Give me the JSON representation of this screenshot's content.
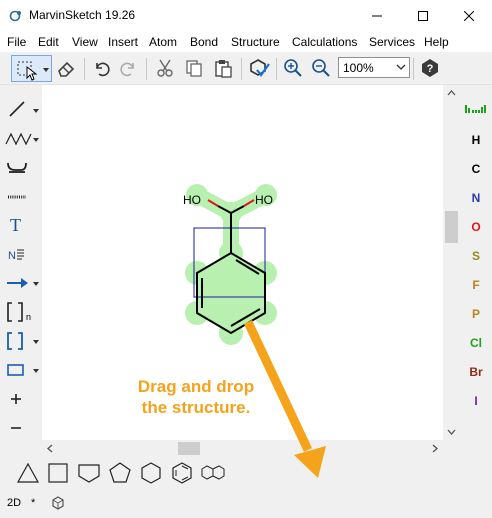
{
  "window": {
    "title": "MarvinSketch 19.26"
  },
  "menu": [
    "File",
    "Edit",
    "View",
    "Insert",
    "Atom",
    "Bond",
    "Structure",
    "Calculations",
    "Services",
    "Help"
  ],
  "toolbar": {
    "zoom_value": "100%",
    "icons": [
      "select-lasso-icon",
      "eraser-icon",
      "undo-icon",
      "redo-icon",
      "cut-icon",
      "copy-icon",
      "paste-icon",
      "clean-structure-icon",
      "zoom-in-icon",
      "zoom-out-icon",
      "help-icon"
    ]
  },
  "left_tools": {
    "text_tool": "T",
    "bracket_label": "n"
  },
  "atoms": [
    {
      "symbol": "H",
      "color": "#000000"
    },
    {
      "symbol": "C",
      "color": "#000000"
    },
    {
      "symbol": "N",
      "color": "#2b3aa8"
    },
    {
      "symbol": "O",
      "color": "#e4141b"
    },
    {
      "symbol": "S",
      "color": "#9b8a1a"
    },
    {
      "symbol": "F",
      "color": "#b8861b"
    },
    {
      "symbol": "P",
      "color": "#b8861b"
    },
    {
      "symbol": "Cl",
      "color": "#1aa31a"
    },
    {
      "symbol": "Br",
      "color": "#8a2a1a"
    },
    {
      "symbol": "I",
      "color": "#7b1fa2"
    }
  ],
  "molecule": {
    "left_group": "HO",
    "right_group": "HO",
    "highlight_color": "#b8f0b0",
    "selection_color": "#1a1aa0"
  },
  "annotation": {
    "line1": "Drag and drop",
    "line2": "the structure.",
    "color": "#f5a31a"
  },
  "status": {
    "mode": "2D",
    "star": "*"
  }
}
